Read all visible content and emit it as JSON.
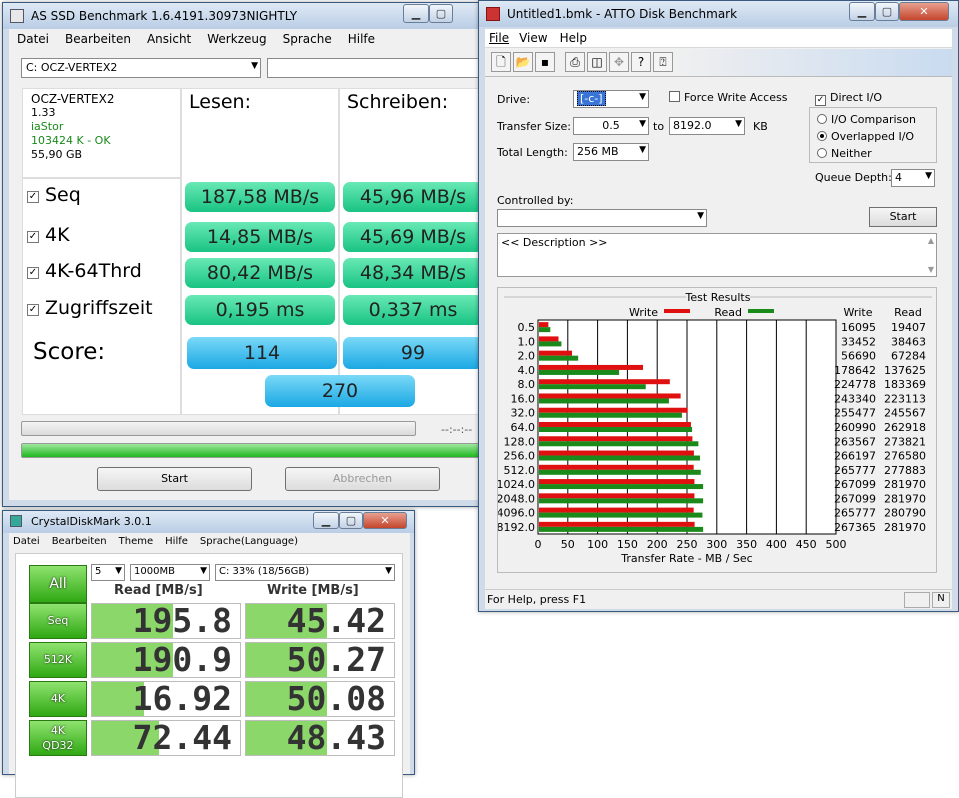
{
  "asssd": {
    "title": "AS SSD Benchmark 1.6.4191.30973NIGHTLY",
    "menu": [
      "Datei",
      "Bearbeiten",
      "Ansicht",
      "Werkzeug",
      "Sprache",
      "Hilfe"
    ],
    "drive": "C: OCZ-VERTEX2",
    "info": {
      "model": "OCZ-VERTEX2",
      "fw": "1.33",
      "driver": "iaStor",
      "align": "103424 K - OK",
      "size": "55,90 GB"
    },
    "read_header": "Lesen:",
    "write_header": "Schreiben:",
    "rows": [
      {
        "label": "Seq",
        "read": "187,58 MB/s",
        "write": "45,96 MB/s"
      },
      {
        "label": "4K",
        "read": "14,85 MB/s",
        "write": "45,69 MB/s"
      },
      {
        "label": "4K-64Thrd",
        "read": "80,42 MB/s",
        "write": "48,34 MB/s"
      },
      {
        "label": "Zugriffszeit",
        "read": "0,195 ms",
        "write": "0,337 ms"
      }
    ],
    "score_label": "Score:",
    "score_read": "114",
    "score_write": "99",
    "score_total": "270",
    "time": "--:--:--",
    "start": "Start",
    "abort": "Abbrechen"
  },
  "cdm": {
    "title": "CrystalDiskMark 3.0.1",
    "menu": [
      "Datei",
      "Bearbeiten",
      "Theme",
      "Hilfe",
      "Sprache(Language)"
    ],
    "all": "All",
    "count": "5",
    "size": "1000MB",
    "drive": "C: 33% (18/56GB)",
    "read_header": "Read [MB/s]",
    "write_header": "Write [MB/s]",
    "rows": [
      {
        "label": "Seq",
        "read": "195.8",
        "write": "45.42",
        "read_frac": 0.55,
        "write_frac": 0.55
      },
      {
        "label": "512K",
        "read": "190.9",
        "write": "50.27",
        "read_frac": 0.55,
        "write_frac": 0.55
      },
      {
        "label": "4K",
        "read": "16.92",
        "write": "50.08",
        "read_frac": 0.35,
        "write_frac": 0.55
      },
      {
        "label": "4K\nQD32",
        "read": "72.44",
        "write": "48.43",
        "read_frac": 0.45,
        "write_frac": 0.55
      }
    ]
  },
  "atto": {
    "title": "Untitled1.bmk - ATTO Disk Benchmark",
    "menu": [
      "File",
      "View",
      "Help"
    ],
    "drive_label": "Drive:",
    "drive": "[-c-]",
    "force_write": "Force Write Access",
    "direct_io": "Direct I/O",
    "transfer_label": "Transfer Size:",
    "transfer_from": "0.5",
    "to": "to",
    "transfer_to": "8192.0",
    "kb": "KB",
    "total_label": "Total Length:",
    "total": "256 MB",
    "io_comparison": "I/O Comparison",
    "overlapped": "Overlapped I/O",
    "neither": "Neither",
    "queue_label": "Queue Depth:",
    "queue": "4",
    "controlled_label": "Controlled by:",
    "start": "Start",
    "description": "<< Description >>",
    "results_title": "Test Results",
    "write_legend": "Write",
    "read_legend": "Read",
    "status": "For Help, press F1"
  },
  "chart_data": {
    "type": "bar",
    "title": "Test Results",
    "xlabel": "Transfer Rate - MB / Sec",
    "xlim": [
      0,
      500
    ],
    "xticks": [
      "0",
      "50",
      "100",
      "150",
      "200",
      "250",
      "300",
      "350",
      "400",
      "450",
      "500"
    ],
    "categories": [
      "0.5",
      "1.0",
      "2.0",
      "4.0",
      "8.0",
      "16.0",
      "32.0",
      "64.0",
      "128.0",
      "256.0",
      "512.0",
      "1024.0",
      "2048.0",
      "4096.0",
      "8192.0"
    ],
    "series": [
      {
        "name": "Write",
        "color": "#e01010",
        "values": [
          15.7,
          32.7,
          55.4,
          174.5,
          219.5,
          237.6,
          249.5,
          254.9,
          257.4,
          259.9,
          259.5,
          260.8,
          260.8,
          259.5,
          261.1
        ]
      },
      {
        "name": "Read",
        "color": "#1a8a1a",
        "values": [
          19.0,
          37.6,
          65.7,
          134.4,
          179.1,
          218.0,
          239.8,
          256.8,
          267.4,
          270.1,
          271.4,
          275.4,
          275.4,
          274.2,
          275.4
        ]
      }
    ],
    "write_header": "Write",
    "read_header": "Read",
    "write_kb": [
      "16095",
      "33452",
      "56690",
      "178642",
      "224778",
      "243340",
      "255477",
      "260990",
      "263567",
      "266197",
      "265777",
      "267099",
      "267099",
      "265777",
      "267365"
    ],
    "read_kb": [
      "19407",
      "38463",
      "67284",
      "137625",
      "183369",
      "223113",
      "245567",
      "262918",
      "273821",
      "276580",
      "277883",
      "281970",
      "281970",
      "280790",
      "281970"
    ]
  }
}
